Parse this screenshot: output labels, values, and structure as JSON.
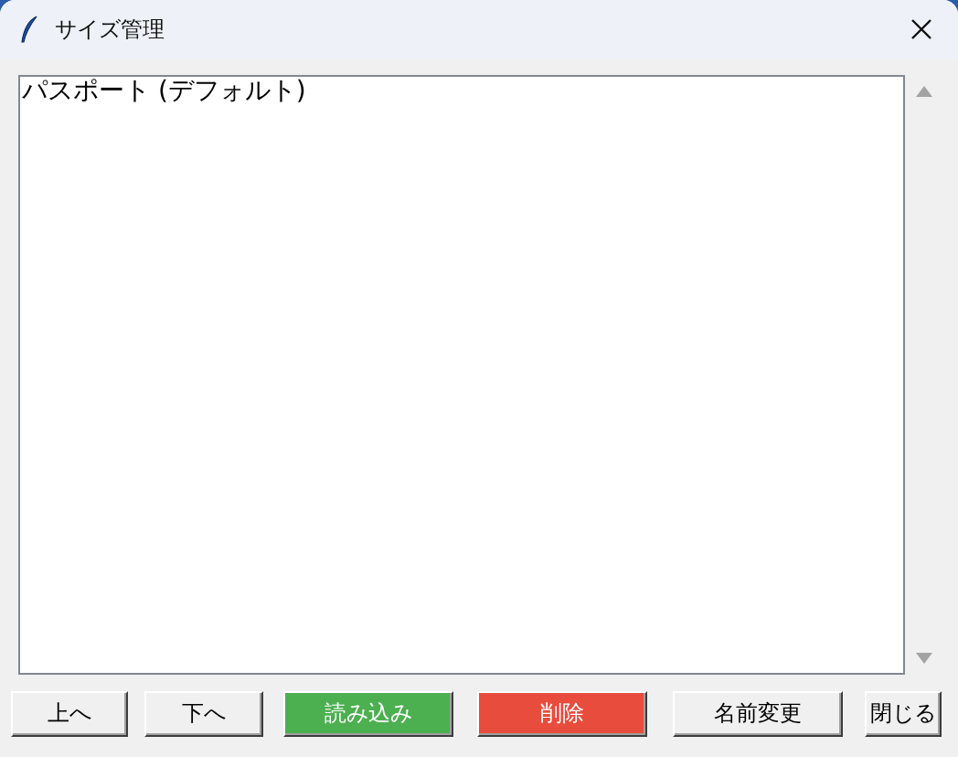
{
  "window": {
    "title": "サイズ管理"
  },
  "list": {
    "items": [
      "パスポート (デフォルト)"
    ]
  },
  "buttons": [
    {
      "label": "上へ",
      "kind": "normal"
    },
    {
      "label": "下へ",
      "kind": "normal"
    },
    {
      "label": "読み込み",
      "kind": "primary"
    },
    {
      "label": "削除",
      "kind": "danger"
    },
    {
      "label": "名前変更",
      "kind": "normal"
    },
    {
      "label": "閉じる",
      "kind": "normal"
    }
  ]
}
